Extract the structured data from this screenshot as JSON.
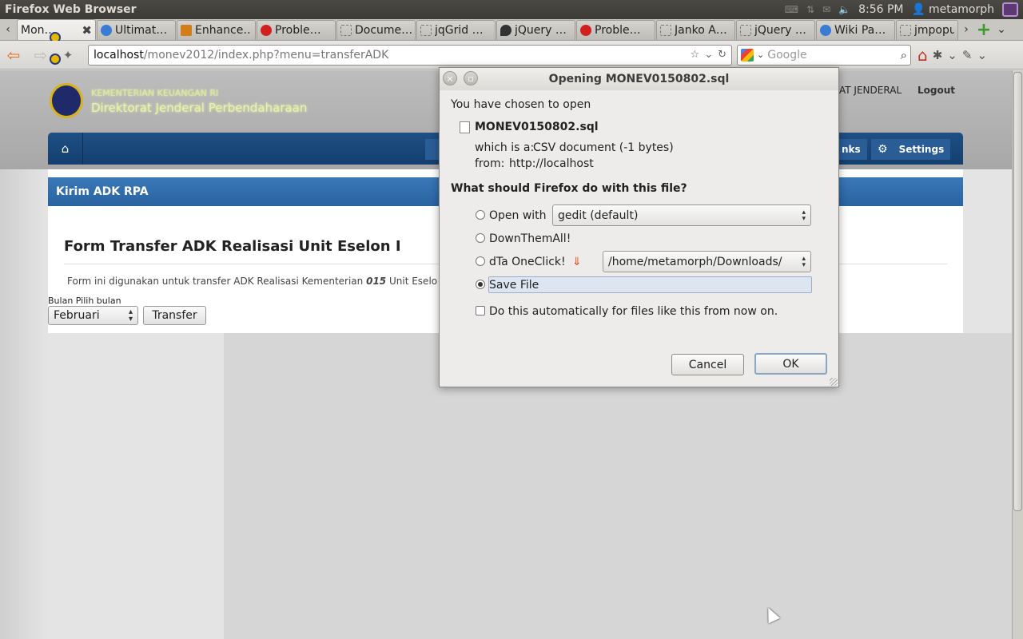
{
  "topbar": {
    "app_title": "Firefox Web Browser",
    "time": "8:56 PM",
    "username": "metamorph",
    "icons": [
      "keyboard-icon",
      "network-icon",
      "mail-icon",
      "volume-icon",
      "clock-icon",
      "user-icon",
      "power-icon"
    ]
  },
  "tabs": [
    {
      "label": "Mon…",
      "active": true,
      "icon": "site-logo-icon"
    },
    {
      "label": "Ultimat…",
      "icon": "globe-icon"
    },
    {
      "label": "Enhance…",
      "icon": "orange-favicon"
    },
    {
      "label": "Proble…",
      "icon": "error-icon"
    },
    {
      "label": "Docume…",
      "icon": "page-icon"
    },
    {
      "label": "jqGrid …",
      "icon": "page-icon"
    },
    {
      "label": "jQuery …",
      "icon": "flame-icon"
    },
    {
      "label": "Proble…",
      "icon": "error-icon"
    },
    {
      "label": "Janko A…",
      "icon": "janko-icon"
    },
    {
      "label": "jQuery …",
      "icon": "page-icon"
    },
    {
      "label": "Wiki Pa…",
      "icon": "wiki-icon"
    },
    {
      "label": "jmpopu",
      "icon": "page-icon"
    }
  ],
  "navbar": {
    "url_host": "localhost",
    "url_path": "/monev2012/index.php?menu=transferADK",
    "search_placeholder": "Google"
  },
  "page": {
    "brand_line1": "KEMENTERIAN KEUANGAN RI",
    "brand_line2": "Direktorat Jenderal Perbendaharaan",
    "user_link": "AT JENDERAL",
    "logout": "Logout",
    "menu_links": "nks",
    "menu_settings": "Settings",
    "section_header": "Kirim ADK RPA",
    "form_title": "Form Transfer ADK Realisasi Unit Eselon I",
    "desc_prefix": "Form ini digunakan untuk transfer ADK Realisasi Kementerian",
    "desc_code": "015",
    "desc_suffix": "Unit Eselo",
    "month_label": "Bulan Pilih bulan",
    "month_value": "Februari",
    "transfer_button": "Transfer"
  },
  "dialog": {
    "title": "Opening MONEV0150802.sql",
    "chosen_text": "You have chosen to open",
    "filename": "MONEV0150802.sql",
    "which_is_label": "which is a:",
    "which_is_value": "CSV document (-1 bytes)",
    "from_label": "from:",
    "from_value": "http://localhost",
    "question": "What should Firefox do with this file?",
    "option_open_with": "Open with",
    "open_with_app": "gedit (default)",
    "option_downthemall": "DownThemAll!",
    "option_dta_oneclick": "dTa OneClick!",
    "dta_path": "/home/metamorph/Downloads/",
    "option_save_file": "Save File",
    "selected_option": "Save File",
    "auto_checkbox": "Do this automatically for files like this from now on.",
    "auto_checked": false,
    "cancel_button": "Cancel",
    "ok_button": "OK"
  }
}
